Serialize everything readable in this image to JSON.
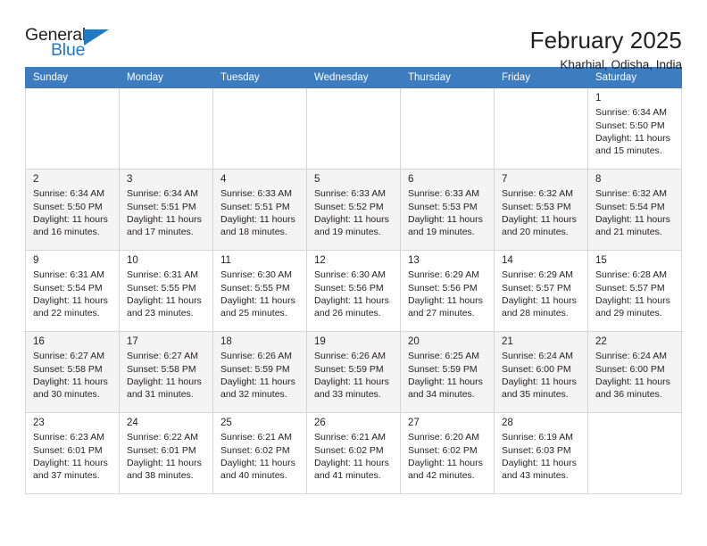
{
  "brand": {
    "name_part1": "General",
    "name_part2": "Blue",
    "accent_color": "#1f7ac4"
  },
  "header": {
    "title": "February 2025",
    "location": "Kharhial, Odisha, India"
  },
  "theme": {
    "header_row_bg": "#3d7dbf",
    "shaded_row_bg": "#f4f4f4",
    "grid_border": "#d6d6d6",
    "text_color": "#231f20"
  },
  "calendar": {
    "weekday_headers": [
      "Sunday",
      "Monday",
      "Tuesday",
      "Wednesday",
      "Thursday",
      "Friday",
      "Saturday"
    ],
    "weeks": [
      {
        "shaded": false,
        "days": [
          {
            "empty": true
          },
          {
            "empty": true
          },
          {
            "empty": true
          },
          {
            "empty": true
          },
          {
            "empty": true
          },
          {
            "empty": true
          },
          {
            "day": "1",
            "sunrise": "Sunrise: 6:34 AM",
            "sunset": "Sunset: 5:50 PM",
            "daylight_line1": "Daylight: 11 hours",
            "daylight_line2": "and 15 minutes."
          }
        ]
      },
      {
        "shaded": true,
        "days": [
          {
            "day": "2",
            "sunrise": "Sunrise: 6:34 AM",
            "sunset": "Sunset: 5:50 PM",
            "daylight_line1": "Daylight: 11 hours",
            "daylight_line2": "and 16 minutes."
          },
          {
            "day": "3",
            "sunrise": "Sunrise: 6:34 AM",
            "sunset": "Sunset: 5:51 PM",
            "daylight_line1": "Daylight: 11 hours",
            "daylight_line2": "and 17 minutes."
          },
          {
            "day": "4",
            "sunrise": "Sunrise: 6:33 AM",
            "sunset": "Sunset: 5:51 PM",
            "daylight_line1": "Daylight: 11 hours",
            "daylight_line2": "and 18 minutes."
          },
          {
            "day": "5",
            "sunrise": "Sunrise: 6:33 AM",
            "sunset": "Sunset: 5:52 PM",
            "daylight_line1": "Daylight: 11 hours",
            "daylight_line2": "and 19 minutes."
          },
          {
            "day": "6",
            "sunrise": "Sunrise: 6:33 AM",
            "sunset": "Sunset: 5:53 PM",
            "daylight_line1": "Daylight: 11 hours",
            "daylight_line2": "and 19 minutes."
          },
          {
            "day": "7",
            "sunrise": "Sunrise: 6:32 AM",
            "sunset": "Sunset: 5:53 PM",
            "daylight_line1": "Daylight: 11 hours",
            "daylight_line2": "and 20 minutes."
          },
          {
            "day": "8",
            "sunrise": "Sunrise: 6:32 AM",
            "sunset": "Sunset: 5:54 PM",
            "daylight_line1": "Daylight: 11 hours",
            "daylight_line2": "and 21 minutes."
          }
        ]
      },
      {
        "shaded": false,
        "days": [
          {
            "day": "9",
            "sunrise": "Sunrise: 6:31 AM",
            "sunset": "Sunset: 5:54 PM",
            "daylight_line1": "Daylight: 11 hours",
            "daylight_line2": "and 22 minutes."
          },
          {
            "day": "10",
            "sunrise": "Sunrise: 6:31 AM",
            "sunset": "Sunset: 5:55 PM",
            "daylight_line1": "Daylight: 11 hours",
            "daylight_line2": "and 23 minutes."
          },
          {
            "day": "11",
            "sunrise": "Sunrise: 6:30 AM",
            "sunset": "Sunset: 5:55 PM",
            "daylight_line1": "Daylight: 11 hours",
            "daylight_line2": "and 25 minutes."
          },
          {
            "day": "12",
            "sunrise": "Sunrise: 6:30 AM",
            "sunset": "Sunset: 5:56 PM",
            "daylight_line1": "Daylight: 11 hours",
            "daylight_line2": "and 26 minutes."
          },
          {
            "day": "13",
            "sunrise": "Sunrise: 6:29 AM",
            "sunset": "Sunset: 5:56 PM",
            "daylight_line1": "Daylight: 11 hours",
            "daylight_line2": "and 27 minutes."
          },
          {
            "day": "14",
            "sunrise": "Sunrise: 6:29 AM",
            "sunset": "Sunset: 5:57 PM",
            "daylight_line1": "Daylight: 11 hours",
            "daylight_line2": "and 28 minutes."
          },
          {
            "day": "15",
            "sunrise": "Sunrise: 6:28 AM",
            "sunset": "Sunset: 5:57 PM",
            "daylight_line1": "Daylight: 11 hours",
            "daylight_line2": "and 29 minutes."
          }
        ]
      },
      {
        "shaded": true,
        "days": [
          {
            "day": "16",
            "sunrise": "Sunrise: 6:27 AM",
            "sunset": "Sunset: 5:58 PM",
            "daylight_line1": "Daylight: 11 hours",
            "daylight_line2": "and 30 minutes."
          },
          {
            "day": "17",
            "sunrise": "Sunrise: 6:27 AM",
            "sunset": "Sunset: 5:58 PM",
            "daylight_line1": "Daylight: 11 hours",
            "daylight_line2": "and 31 minutes."
          },
          {
            "day": "18",
            "sunrise": "Sunrise: 6:26 AM",
            "sunset": "Sunset: 5:59 PM",
            "daylight_line1": "Daylight: 11 hours",
            "daylight_line2": "and 32 minutes."
          },
          {
            "day": "19",
            "sunrise": "Sunrise: 6:26 AM",
            "sunset": "Sunset: 5:59 PM",
            "daylight_line1": "Daylight: 11 hours",
            "daylight_line2": "and 33 minutes."
          },
          {
            "day": "20",
            "sunrise": "Sunrise: 6:25 AM",
            "sunset": "Sunset: 5:59 PM",
            "daylight_line1": "Daylight: 11 hours",
            "daylight_line2": "and 34 minutes."
          },
          {
            "day": "21",
            "sunrise": "Sunrise: 6:24 AM",
            "sunset": "Sunset: 6:00 PM",
            "daylight_line1": "Daylight: 11 hours",
            "daylight_line2": "and 35 minutes."
          },
          {
            "day": "22",
            "sunrise": "Sunrise: 6:24 AM",
            "sunset": "Sunset: 6:00 PM",
            "daylight_line1": "Daylight: 11 hours",
            "daylight_line2": "and 36 minutes."
          }
        ]
      },
      {
        "shaded": false,
        "days": [
          {
            "day": "23",
            "sunrise": "Sunrise: 6:23 AM",
            "sunset": "Sunset: 6:01 PM",
            "daylight_line1": "Daylight: 11 hours",
            "daylight_line2": "and 37 minutes."
          },
          {
            "day": "24",
            "sunrise": "Sunrise: 6:22 AM",
            "sunset": "Sunset: 6:01 PM",
            "daylight_line1": "Daylight: 11 hours",
            "daylight_line2": "and 38 minutes."
          },
          {
            "day": "25",
            "sunrise": "Sunrise: 6:21 AM",
            "sunset": "Sunset: 6:02 PM",
            "daylight_line1": "Daylight: 11 hours",
            "daylight_line2": "and 40 minutes."
          },
          {
            "day": "26",
            "sunrise": "Sunrise: 6:21 AM",
            "sunset": "Sunset: 6:02 PM",
            "daylight_line1": "Daylight: 11 hours",
            "daylight_line2": "and 41 minutes."
          },
          {
            "day": "27",
            "sunrise": "Sunrise: 6:20 AM",
            "sunset": "Sunset: 6:02 PM",
            "daylight_line1": "Daylight: 11 hours",
            "daylight_line2": "and 42 minutes."
          },
          {
            "day": "28",
            "sunrise": "Sunrise: 6:19 AM",
            "sunset": "Sunset: 6:03 PM",
            "daylight_line1": "Daylight: 11 hours",
            "daylight_line2": "and 43 minutes."
          },
          {
            "empty": true
          }
        ]
      }
    ]
  }
}
